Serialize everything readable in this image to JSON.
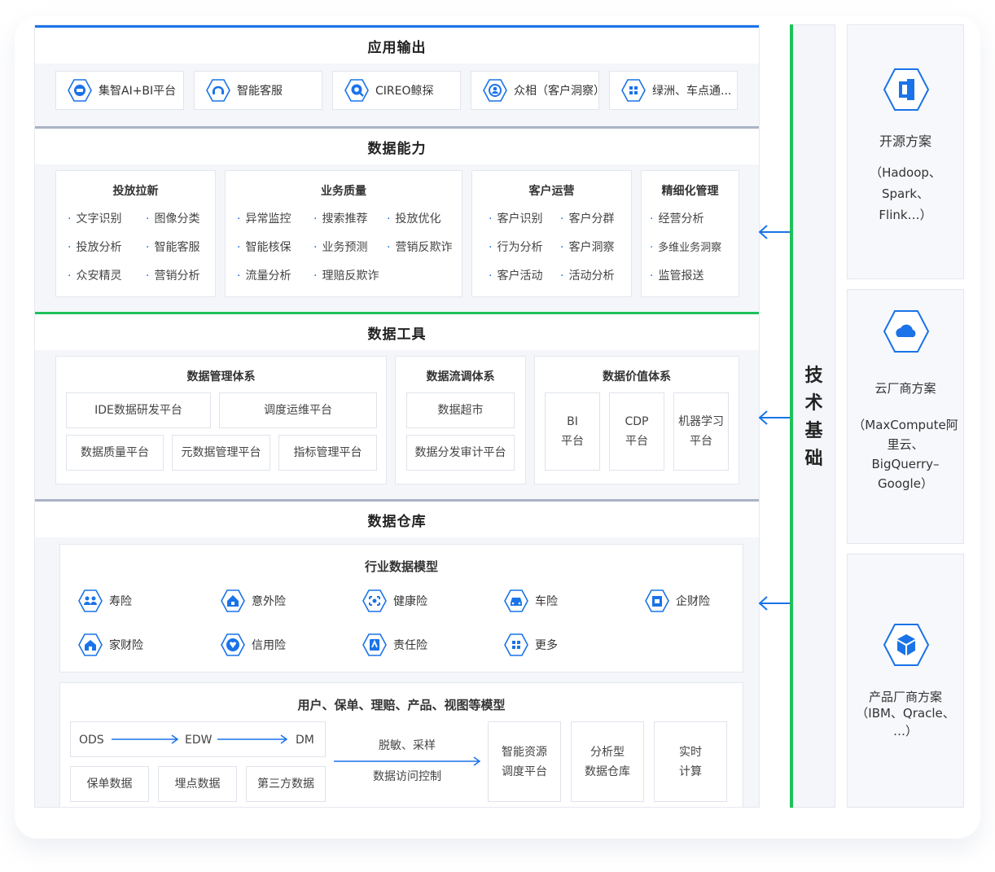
{
  "colors": {
    "blue": "#1a73e8",
    "green": "#1dc15a",
    "grey_bar": "#aab3c5"
  },
  "app_output": {
    "title": "应用输出",
    "items": [
      {
        "label": "集智AI+BI平台",
        "icon": "ai-bi-icon"
      },
      {
        "label": "智能客服",
        "icon": "headset-icon"
      },
      {
        "label": "CIREO鲸探",
        "icon": "search-chat-icon"
      },
      {
        "label": "众相（客户洞察）",
        "icon": "user-insight-icon"
      },
      {
        "label": "绿洲、车点通...",
        "icon": "grid-icon"
      }
    ]
  },
  "data_capability": {
    "title": "数据能力",
    "groups": [
      {
        "title": "投放拉新",
        "items": [
          "文字识别",
          "图像分类",
          "投放分析",
          "智能客服",
          "众安精灵",
          "营销分析"
        ]
      },
      {
        "title": "业务质量",
        "items": [
          "异常监控",
          "搜索推荐",
          "投放优化",
          "智能核保",
          "业务预测",
          "营销反欺诈",
          "流量分析",
          "理赔反欺诈"
        ]
      },
      {
        "title": "客户运营",
        "items": [
          "客户识别",
          "客户分群",
          "行为分析",
          "客户洞察",
          "客户活动",
          "活动分析"
        ]
      },
      {
        "title": "精细化管理",
        "items": [
          "经营分析",
          "多维业务洞察",
          "监管报送"
        ]
      }
    ]
  },
  "data_tools": {
    "title": "数据工具",
    "mgmt": {
      "title": "数据管理体系",
      "items": [
        "IDE数据研发平台",
        "调度运维平台",
        "数据质量平台",
        "元数据管理平台",
        "指标管理平台"
      ]
    },
    "flow": {
      "title": "数据流调体系",
      "items": [
        "数据超市",
        "数据分发审计平台"
      ]
    },
    "value": {
      "title": "数据价值体系",
      "items": [
        [
          "BI",
          "平台"
        ],
        [
          "CDP",
          "平台"
        ],
        [
          "机器学习",
          "平台"
        ]
      ]
    }
  },
  "warehouse": {
    "title": "数据仓库",
    "industry": {
      "title": "行业数据模型",
      "items": [
        {
          "label": "寿险",
          "icon": "people-icon"
        },
        {
          "label": "意外险",
          "icon": "home-alert-icon"
        },
        {
          "label": "健康险",
          "icon": "health-icon"
        },
        {
          "label": "车险",
          "icon": "car-icon"
        },
        {
          "label": "企财险",
          "icon": "building-icon"
        },
        {
          "label": "家财险",
          "icon": "house-icon"
        },
        {
          "label": "信用险",
          "icon": "heart-icon"
        },
        {
          "label": "责任险",
          "icon": "document-icon"
        },
        {
          "label": "更多",
          "icon": "grid-icon"
        }
      ]
    },
    "model": {
      "title": "用户、保单、理赔、产品、视图等模型",
      "flow": [
        "ODS",
        "EDW",
        "DM"
      ],
      "sources": [
        "保单数据",
        "埋点数据",
        "第三方数据"
      ],
      "process_top": "脱敏、采样",
      "process_bottom": "数据访问控制",
      "targets": [
        [
          "智能资源",
          "调度平台"
        ],
        [
          "分析型",
          "数据仓库"
        ],
        [
          "实时",
          "计算"
        ]
      ]
    }
  },
  "tech_base": {
    "label": [
      "技",
      "术",
      "基",
      "础"
    ]
  },
  "right": [
    {
      "title": "开源方案",
      "detail": [
        "（Hadoop、",
        "Spark、",
        "Flink…）"
      ],
      "icon": "open-source-icon"
    },
    {
      "title": "云厂商方案",
      "detail": [
        "（MaxCompute阿",
        "里云、",
        "BigQuerry–",
        "Google）"
      ],
      "icon": "cloud-icon"
    },
    {
      "title": "产品厂商方案",
      "detail": [
        "（IBM、Qracle、",
        "…）"
      ],
      "icon": "cube-icon"
    }
  ]
}
